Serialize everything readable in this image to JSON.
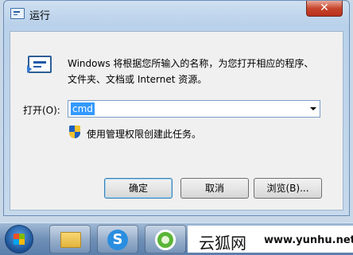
{
  "window": {
    "title": "运行",
    "close_label": "✕"
  },
  "dialog": {
    "description": "Windows 将根据您所输入的名称，为您打开相应的程序、文件夹、文档或 Internet 资源。",
    "open_label": "打开(O):",
    "open_value": "cmd",
    "admin_note": "使用管理权限创建此任务。"
  },
  "buttons": {
    "ok": "确定",
    "cancel": "取消",
    "browse": "浏览(B)..."
  },
  "taskbar": {
    "items": [
      "start-orb",
      "explorer-icon",
      "sogou-icon",
      "green-app-icon"
    ]
  },
  "watermark": {
    "brand": "云狐网",
    "url": "www.yunhu.net"
  },
  "colors": {
    "selection": "#3399ff",
    "close_button": "#c7452d"
  }
}
